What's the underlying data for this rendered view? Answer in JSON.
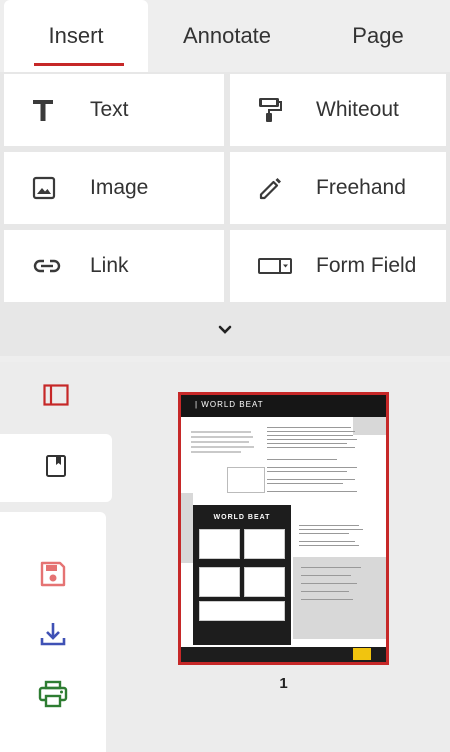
{
  "tabs": [
    {
      "label": "Insert",
      "active": true
    },
    {
      "label": "Annotate",
      "active": false
    },
    {
      "label": "Page",
      "active": false
    }
  ],
  "insert_tools": [
    {
      "label": "Text",
      "icon": "text-icon"
    },
    {
      "label": "Whiteout",
      "icon": "paint-roller-icon"
    },
    {
      "label": "Image",
      "icon": "image-icon"
    },
    {
      "label": "Freehand",
      "icon": "pencil-icon"
    },
    {
      "label": "Link",
      "icon": "link-icon"
    },
    {
      "label": "Form Field",
      "icon": "form-field-icon"
    }
  ],
  "expand_icon": "chevron-down-icon",
  "sidebar": {
    "panel_icon": "sidebar-panel-icon",
    "bookmark_icon": "bookmark-icon"
  },
  "actions": [
    {
      "icon": "save-icon",
      "color": "#e57373"
    },
    {
      "icon": "download-icon",
      "color": "#3f51b5"
    },
    {
      "icon": "print-icon",
      "color": "#2e7d32"
    }
  ],
  "thumbnail": {
    "header_text": "|  WORLD BEAT",
    "inner_title": "WORLD BEAT",
    "page_number": "1",
    "selected_border": "#c62828"
  },
  "colors": {
    "accent": "#c62828"
  }
}
